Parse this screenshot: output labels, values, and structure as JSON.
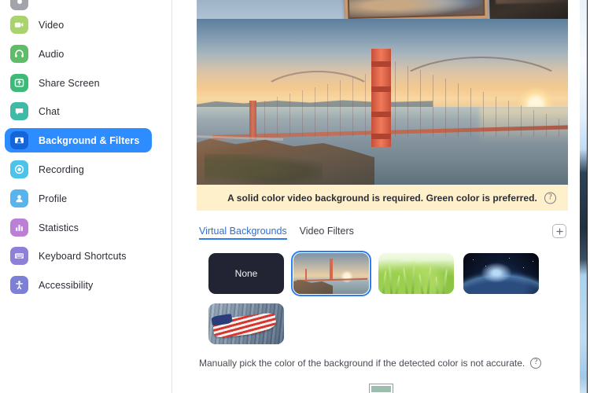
{
  "app": {
    "accent_color": "#2d8cff",
    "banner_bg": "#fdf0cb",
    "selected_outline": "#2d7ff0"
  },
  "sidebar": {
    "items": [
      {
        "label": "Video",
        "icon": "video-camera-icon",
        "color": "#a9d36d",
        "selected": false
      },
      {
        "label": "Audio",
        "icon": "headphones-icon",
        "color": "#5fbd6a",
        "selected": false
      },
      {
        "label": "Share Screen",
        "icon": "share-screen-icon",
        "color": "#3dba78",
        "selected": false
      },
      {
        "label": "Chat",
        "icon": "chat-bubble-icon",
        "color": "#3fbaa6",
        "selected": false
      },
      {
        "label": "Background & Filters",
        "icon": "person-card-icon",
        "color": "#2d8cff",
        "selected": true
      },
      {
        "label": "Recording",
        "icon": "record-circle-icon",
        "color": "#4cc3e8",
        "selected": false
      },
      {
        "label": "Profile",
        "icon": "person-icon",
        "color": "#5ab4ec",
        "selected": false
      },
      {
        "label": "Statistics",
        "icon": "bar-chart-icon",
        "color": "#bb80d6",
        "selected": false
      },
      {
        "label": "Keyboard Shortcuts",
        "icon": "keyboard-icon",
        "color": "#8d80d6",
        "selected": false
      },
      {
        "label": "Accessibility",
        "icon": "accessibility-icon",
        "color": "#7c80d6",
        "selected": false
      }
    ]
  },
  "main": {
    "banner": {
      "text": "A solid color video background is required. Green color is preferred.",
      "help_icon": "help-circle-icon",
      "help_glyph": "?"
    },
    "tabs": [
      {
        "label": "Virtual Backgrounds",
        "active": true
      },
      {
        "label": "Video Filters",
        "active": false
      }
    ],
    "add_button": {
      "icon": "plus-icon",
      "label": "+"
    },
    "backgrounds": [
      {
        "name": "None",
        "type": "none",
        "selected": false
      },
      {
        "name": "Golden Gate Bridge",
        "type": "bridge",
        "selected": true
      },
      {
        "name": "Green Grass",
        "type": "grass",
        "selected": false
      },
      {
        "name": "Earth From Space",
        "type": "earth",
        "selected": false
      },
      {
        "name": "American Flag",
        "type": "flag",
        "selected": false
      }
    ],
    "hint": {
      "text": "Manually pick the color of the background if the detected color is not accurate.",
      "help_icon": "help-circle-icon",
      "help_glyph": "?"
    },
    "color_swatch": {
      "name": "detected-background-color",
      "value": "#9dbeae"
    }
  }
}
